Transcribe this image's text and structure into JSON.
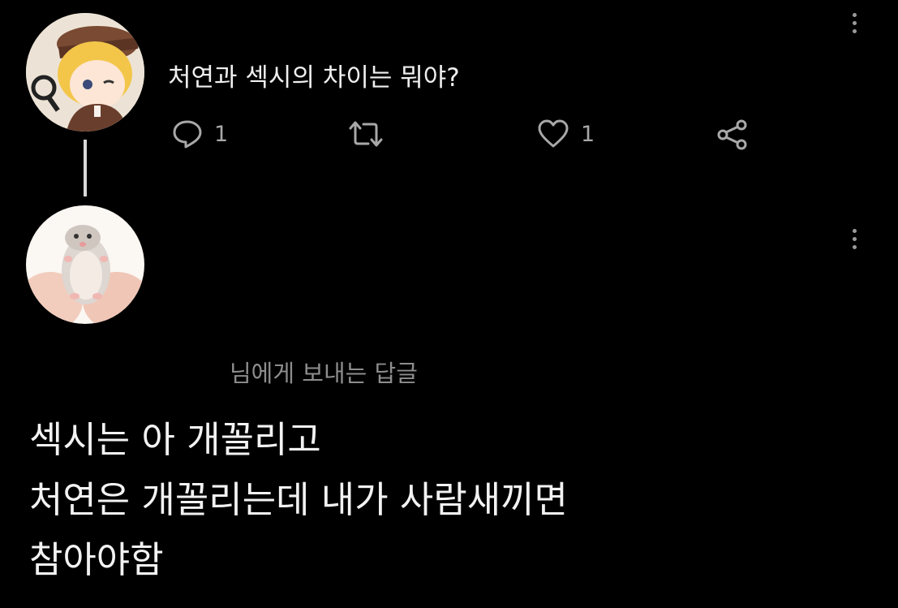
{
  "post": {
    "text": "처연과 섹시의 차이는 뭐야?",
    "reply_count": "1",
    "like_count": "1",
    "avatar": "anime-character-avatar",
    "icons": {
      "reply": "comment-icon",
      "retweet": "retweet-icon",
      "like": "heart-icon",
      "share": "share-icon",
      "more": "more-vertical-icon"
    }
  },
  "reply": {
    "avatar": "hedgehog-avatar",
    "reply_to": "님에게 보내는 답글",
    "lines": [
      "섹시는 아 개꼴리고",
      "처연은 개꼴리는데 내가 사람새끼면",
      "참아야함"
    ]
  },
  "colors": {
    "background": "#000000",
    "text": "#efefef",
    "muted": "#8d8d8d",
    "icon": "#a8a8a8"
  }
}
